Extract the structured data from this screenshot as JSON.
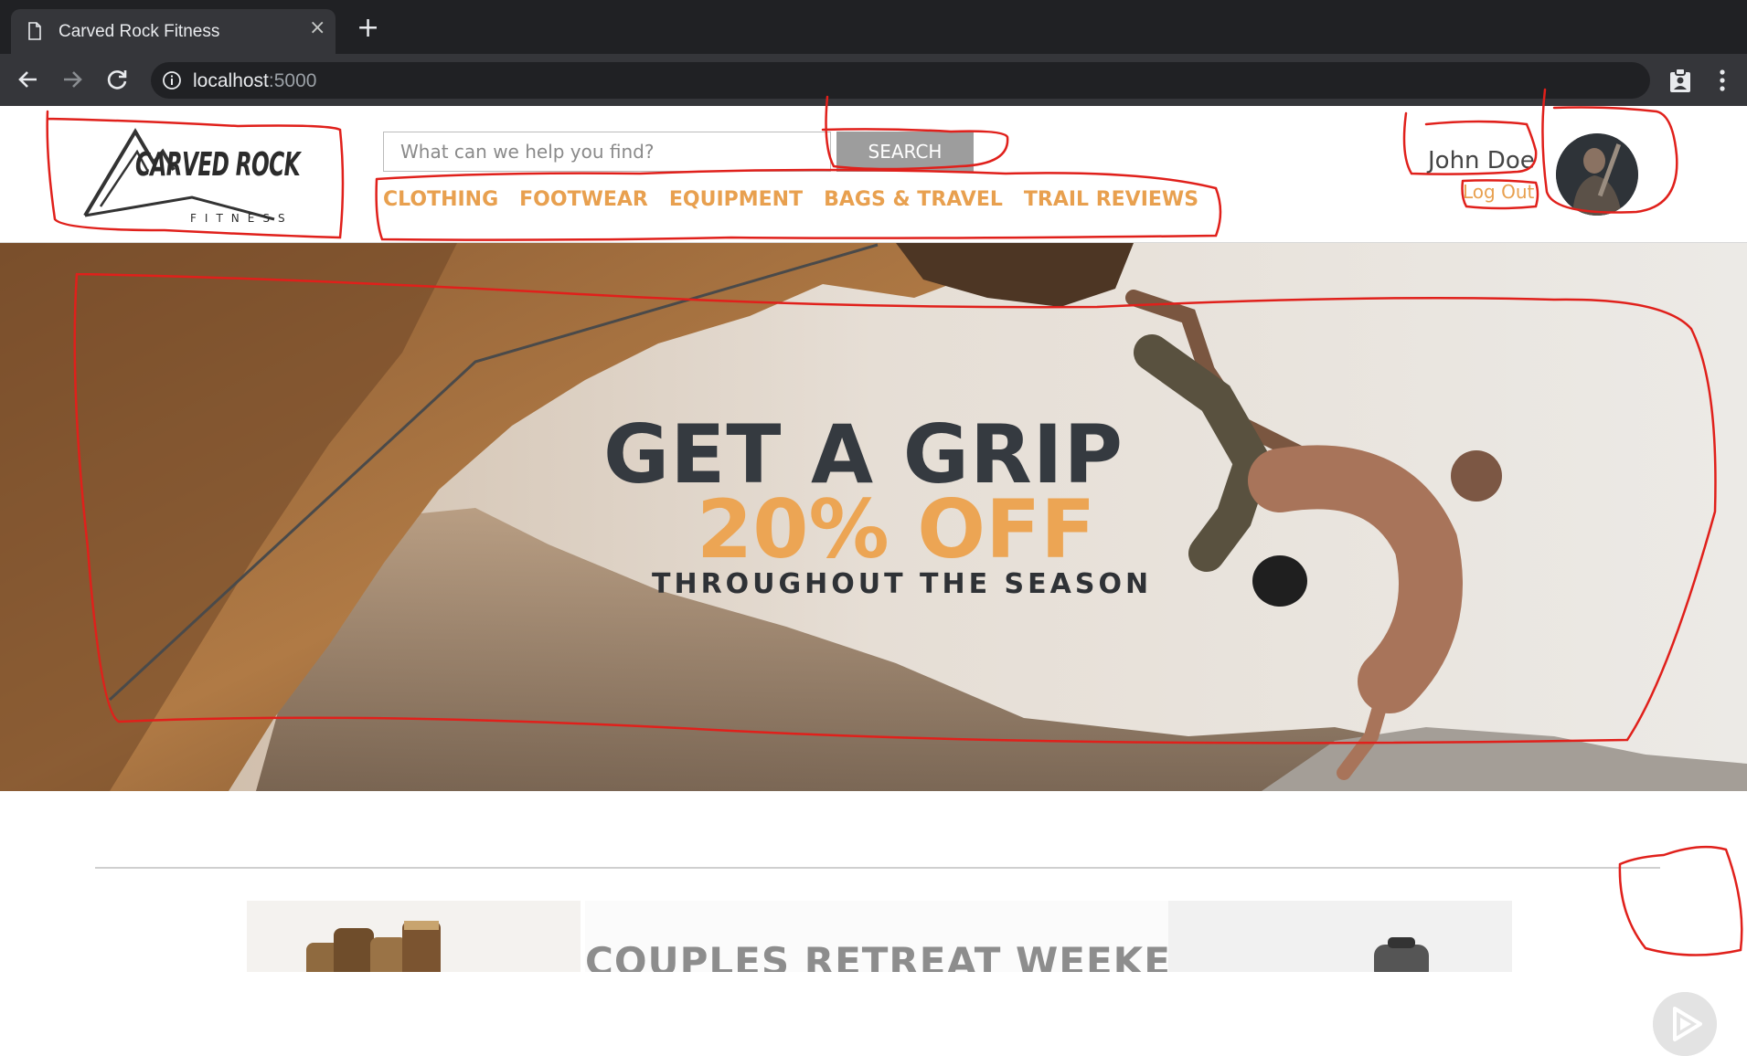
{
  "browser": {
    "tab_title": "Carved Rock Fitness",
    "tab_close": "×",
    "new_tab": "+",
    "url_host": "localhost",
    "url_port": ":5000"
  },
  "header": {
    "logo_text": "CARVED ROCK",
    "logo_sub": "FITNESS",
    "search_placeholder": "What can we help you find?",
    "search_button": "SEARCH",
    "nav": [
      "CLOTHING",
      "FOOTWEAR",
      "EQUIPMENT",
      "BAGS & TRAVEL",
      "TRAIL REVIEWS"
    ],
    "user_name": "John Doe",
    "logout": "Log Out"
  },
  "hero": {
    "title": "GET A GRIP",
    "discount": "20% OFF",
    "subtitle": "THROUGHOUT THE SEASON"
  },
  "promo": {
    "center_title": "COUPLES RETREAT WEEKEND"
  },
  "colors": {
    "accent_orange": "#e8a04f",
    "annotation_red": "#e0201b"
  },
  "icons": [
    "page-icon",
    "back-arrow-icon",
    "forward-arrow-icon",
    "reload-icon",
    "info-icon",
    "extension-icon",
    "menu-dots-icon",
    "play-icon"
  ]
}
